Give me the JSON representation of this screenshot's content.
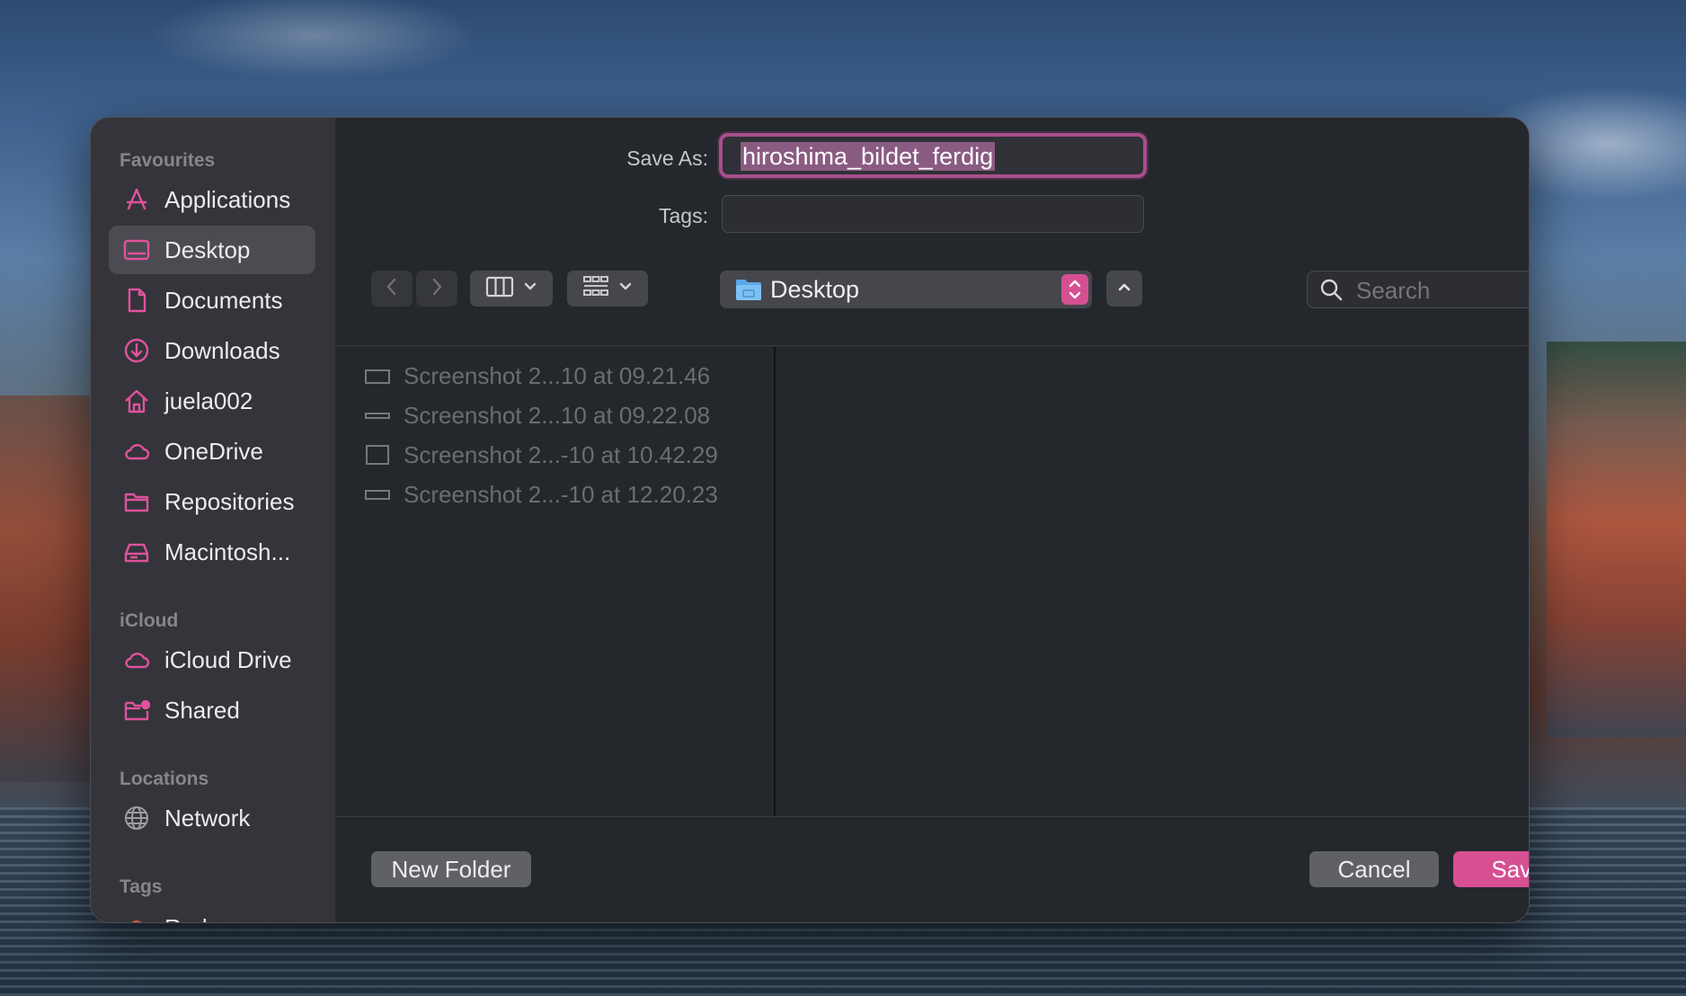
{
  "sidebar": {
    "favourites_heading": "Favourites",
    "favourites": [
      {
        "label": "Applications",
        "icon": "applications-icon"
      },
      {
        "label": "Desktop",
        "icon": "desktop-icon"
      },
      {
        "label": "Documents",
        "icon": "document-icon"
      },
      {
        "label": "Downloads",
        "icon": "downloads-icon"
      },
      {
        "label": "juela002",
        "icon": "home-icon"
      },
      {
        "label": "OneDrive",
        "icon": "cloud-icon"
      },
      {
        "label": "Repositories",
        "icon": "folder-icon"
      },
      {
        "label": "Macintosh...",
        "icon": "hard-drive-icon"
      }
    ],
    "selected": "Desktop",
    "icloud_heading": "iCloud",
    "icloud": [
      {
        "label": "iCloud Drive",
        "icon": "cloud-icon"
      },
      {
        "label": "Shared",
        "icon": "shared-folder-icon"
      }
    ],
    "locations_heading": "Locations",
    "locations": [
      {
        "label": "Network",
        "icon": "globe-icon"
      }
    ],
    "tags_heading": "Tags",
    "tags": [
      {
        "label": "Red",
        "color": "#e5533d"
      }
    ]
  },
  "form": {
    "save_as_label": "Save As:",
    "save_as_value": "hiroshima_bildet_ferdig",
    "tags_label": "Tags:",
    "tags_value": ""
  },
  "toolbar": {
    "back_icon": "chevron-left-icon",
    "forward_icon": "chevron-right-icon",
    "view_mode_icon": "columns-view-icon",
    "group_icon": "grid-view-icon",
    "location": "Desktop",
    "search_placeholder": "Search"
  },
  "files": [
    {
      "name": "Screenshot 2...10 at 09.21.46"
    },
    {
      "name": "Screenshot 2...10 at 09.22.08"
    },
    {
      "name": "Screenshot 2...-10 at 10.42.29"
    },
    {
      "name": "Screenshot 2...-10 at 12.20.23"
    }
  ],
  "buttons": {
    "new_folder": "New Folder",
    "cancel": "Cancel",
    "save": "Save"
  },
  "colors": {
    "accent": "#d64f93",
    "sidebar_icon": "#e0529c",
    "focus_ring": "#a84f8d"
  }
}
